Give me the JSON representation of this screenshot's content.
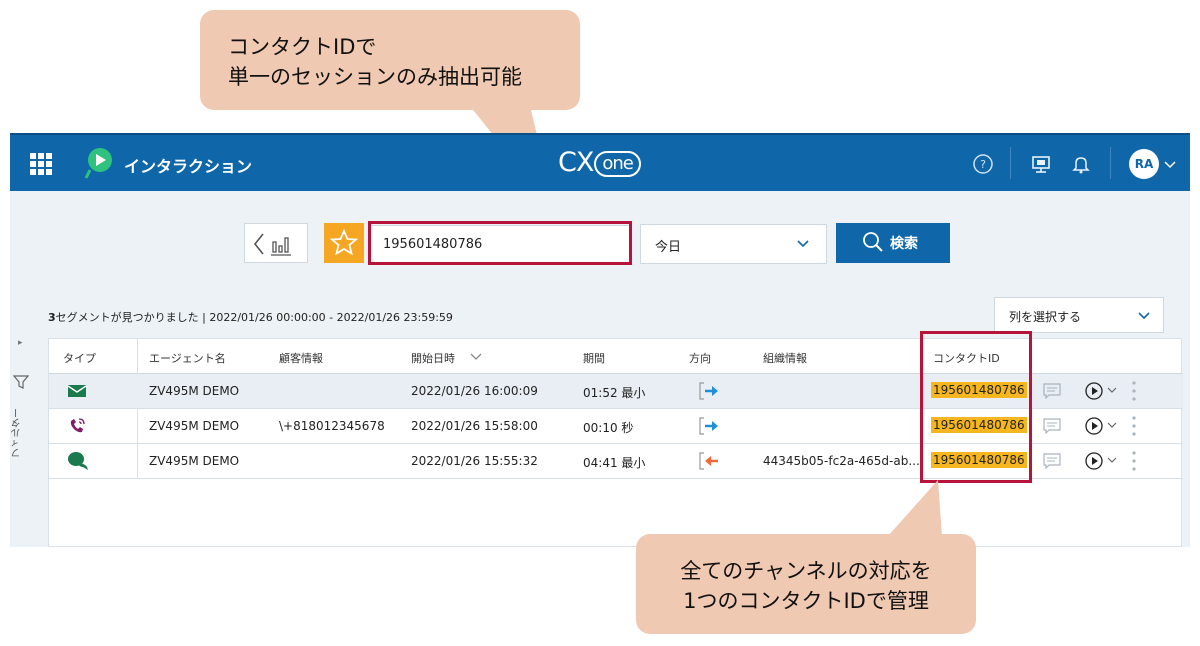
{
  "callouts": {
    "top_line1": "コンタクトIDで",
    "top_line2": "単一のセッションのみ抽出可能",
    "bottom_line1": "全てのチャンネルの対応を",
    "bottom_line2": "1つのコンタクトIDで管理"
  },
  "header": {
    "app_title": "インタラクション",
    "logo_cx": "CX",
    "logo_one": "one",
    "avatar": "RA"
  },
  "search": {
    "value": "195601480786",
    "date_range": "今日",
    "search_label": "検索"
  },
  "summary": {
    "count": "3",
    "text": "セグメントが見つかりました | 2022/01/26 00:00:00 - 2022/01/26 23:59:59"
  },
  "column_select": "列を選択する",
  "rail": {
    "label": "フィルター"
  },
  "table": {
    "headers": {
      "type": "タイプ",
      "agent": "エージェント名",
      "customer": "顧客情報",
      "start": "開始日時",
      "duration": "期間",
      "direction": "方向",
      "org": "組織情報",
      "contact_id": "コンタクトID"
    },
    "rows": [
      {
        "type": "email",
        "agent": "ZV495M DEMO",
        "customer": "",
        "start": "2022/01/26 16:00:09",
        "duration": "01:52 最小",
        "direction": "outbound",
        "org": "",
        "contact_id": "195601480786"
      },
      {
        "type": "phone",
        "agent": "ZV495M DEMO",
        "customer": "\\+818012345678",
        "start": "2022/01/26 15:58:00",
        "duration": "00:10 秒",
        "direction": "outbound",
        "org": "",
        "contact_id": "195601480786"
      },
      {
        "type": "chat",
        "agent": "ZV495M DEMO",
        "customer": "",
        "start": "2022/01/26 15:55:32",
        "duration": "04:41 最小",
        "direction": "inbound",
        "org": "44345b05-fc2a-465d-ab...",
        "contact_id": "195601480786"
      }
    ]
  },
  "colors": {
    "topbar": "#0f66a8",
    "highlight_border": "#b8133a",
    "contact_id_highlight": "#f5b61f",
    "callout": "#f0c9b3",
    "outbound_arrow": "#1f8fd6",
    "inbound_arrow": "#f06a3a"
  }
}
